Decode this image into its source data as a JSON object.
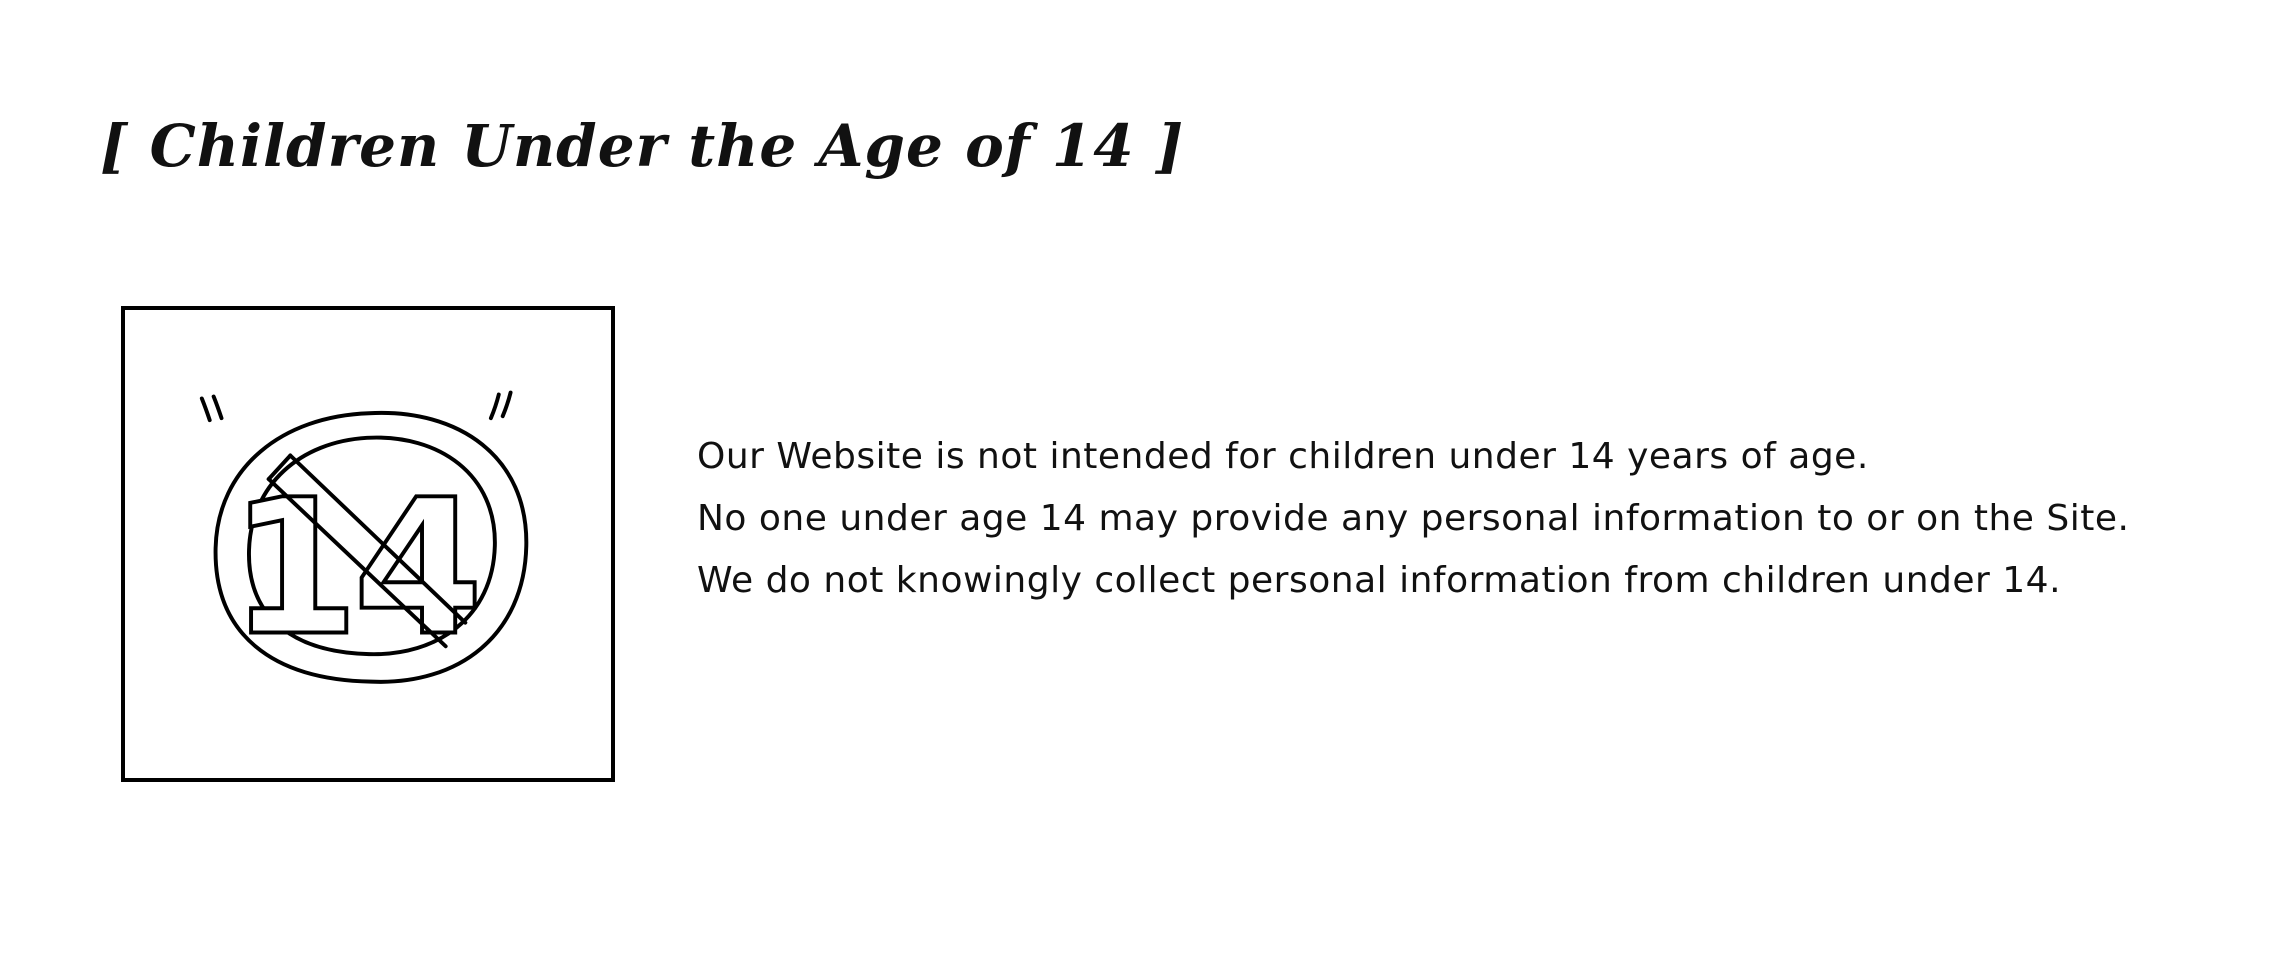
{
  "heading": "[ Children Under the Age of 14 ]",
  "illustration": {
    "icon": "no-under-14-icon",
    "symbol_text": "14"
  },
  "notice": {
    "lines": [
      "Our Website is not intended for children under 14 years of age.",
      "No one under age 14 may provide any personal information to or on the Site.",
      "We do not knowingly collect personal information from children under 14."
    ]
  }
}
